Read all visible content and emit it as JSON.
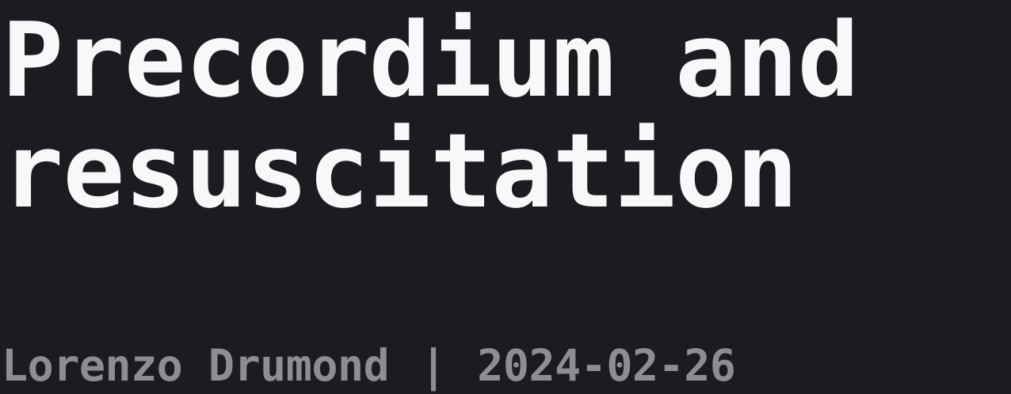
{
  "document": {
    "title_line_1": "Precordium and",
    "title_line_2": "resuscitation",
    "author": "Lorenzo Drumond",
    "separator": "|",
    "date": "2024-02-26"
  },
  "colors": {
    "background": "#1b1c21",
    "title": "#f8f8f8",
    "byline": "#8d8e92"
  }
}
